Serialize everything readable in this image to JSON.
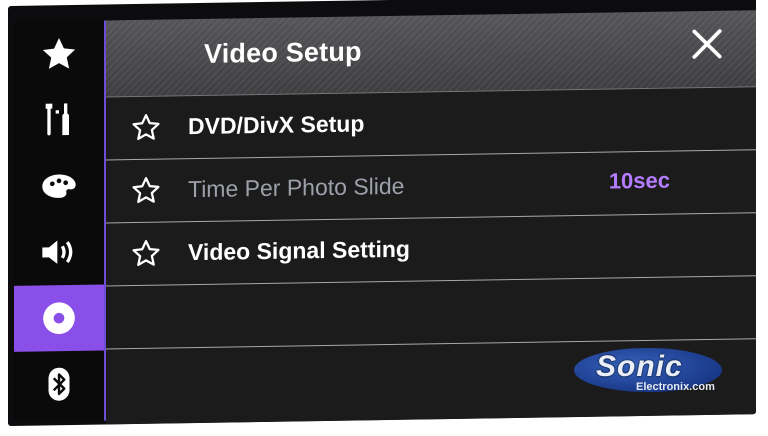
{
  "header": {
    "title": "Video Setup",
    "close_icon": "close-icon"
  },
  "sidebar": {
    "items": [
      {
        "name": "favorites",
        "icon": "star-icon",
        "active": false
      },
      {
        "name": "system",
        "icon": "tools-icon",
        "active": false
      },
      {
        "name": "theme",
        "icon": "palette-icon",
        "active": false
      },
      {
        "name": "audio",
        "icon": "speaker-icon",
        "active": false
      },
      {
        "name": "video",
        "icon": "disc-icon",
        "active": true
      },
      {
        "name": "bluetooth",
        "icon": "bluetooth-icon",
        "active": false
      }
    ],
    "active_color": "#8a4fe8"
  },
  "menu": {
    "items": [
      {
        "label": "DVD/DivX Setup",
        "value": "",
        "enabled": true,
        "icon": "star-outline-icon"
      },
      {
        "label": "Time Per Photo Slide",
        "value": "10sec",
        "enabled": false,
        "icon": "star-outline-icon"
      },
      {
        "label": "Video Signal Setting",
        "value": "",
        "enabled": true,
        "icon": "star-outline-icon"
      }
    ],
    "value_color": "#b57cff"
  },
  "watermark": {
    "brand": "Sonic",
    "sub": "Electronix.com"
  }
}
